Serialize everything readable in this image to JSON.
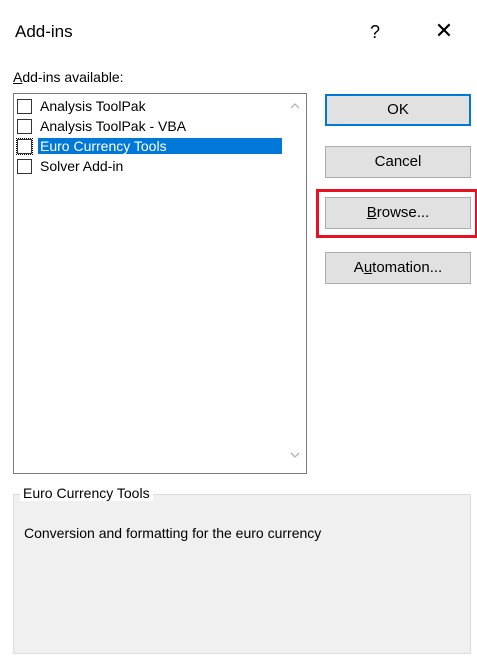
{
  "window": {
    "title": "Add-ins",
    "help_glyph": "?",
    "close_glyph": "✕"
  },
  "addins": {
    "label_underlined": "A",
    "label_rest": "dd-ins available:",
    "items": [
      {
        "label": "Analysis ToolPak",
        "checked": false,
        "selected": false
      },
      {
        "label": "Analysis ToolPak - VBA",
        "checked": false,
        "selected": false
      },
      {
        "label": "Euro Currency Tools",
        "checked": false,
        "selected": true
      },
      {
        "label": "Solver Add-in",
        "checked": false,
        "selected": false
      }
    ]
  },
  "buttons": {
    "ok": "OK",
    "cancel": "Cancel",
    "browse_mnemonic": "B",
    "browse_rest": "rowse...",
    "automation_pre": "A",
    "automation_mnemonic": "u",
    "automation_rest": "tomation..."
  },
  "description": {
    "title": "Euro Currency Tools",
    "text": "Conversion and formatting for the euro currency"
  },
  "colors": {
    "selection": "#0078d7",
    "highlight_box": "#e81123"
  }
}
